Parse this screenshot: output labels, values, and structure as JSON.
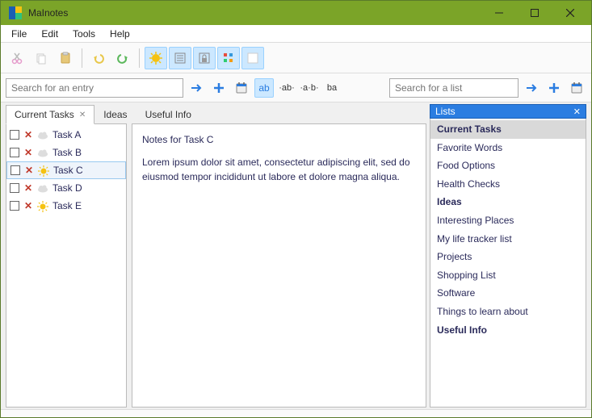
{
  "window": {
    "title": "MaInotes"
  },
  "menu": {
    "file": "File",
    "edit": "Edit",
    "tools": "Tools",
    "help": "Help"
  },
  "search": {
    "entry_placeholder": "Search for an entry",
    "list_placeholder": "Search for a list",
    "opt_ab": "ab",
    "opt_dot_ab": "·ab·",
    "opt_ab_dot": "·a·b·",
    "opt_ba": "ba"
  },
  "tabs": [
    {
      "label": "Current Tasks",
      "closable": true,
      "active": true
    },
    {
      "label": "Ideas",
      "closable": false,
      "active": false
    },
    {
      "label": "Useful Info",
      "closable": false,
      "active": false
    }
  ],
  "tasks": [
    {
      "label": "Task A",
      "selected": false,
      "sunny": false
    },
    {
      "label": "Task B",
      "selected": false,
      "sunny": false
    },
    {
      "label": "Task C",
      "selected": true,
      "sunny": true
    },
    {
      "label": "Task D",
      "selected": false,
      "sunny": false
    },
    {
      "label": "Task E",
      "selected": false,
      "sunny": true
    }
  ],
  "notes": {
    "title": "Notes for Task C",
    "body": "Lorem ipsum dolor sit amet, consectetur adipiscing elit, sed do eiusmod tempor incididunt ut labore et dolore magna aliqua."
  },
  "lists_panel": {
    "title": "Lists",
    "items": [
      {
        "label": "Current Tasks",
        "bold": true,
        "selected": true
      },
      {
        "label": "Favorite Words",
        "bold": false,
        "selected": false
      },
      {
        "label": "Food Options",
        "bold": false,
        "selected": false
      },
      {
        "label": "Health Checks",
        "bold": false,
        "selected": false
      },
      {
        "label": "Ideas",
        "bold": true,
        "selected": false
      },
      {
        "label": "Interesting Places",
        "bold": false,
        "selected": false
      },
      {
        "label": "My life tracker list",
        "bold": false,
        "selected": false
      },
      {
        "label": "Projects",
        "bold": false,
        "selected": false
      },
      {
        "label": "Shopping List",
        "bold": false,
        "selected": false
      },
      {
        "label": "Software",
        "bold": false,
        "selected": false
      },
      {
        "label": "Things to learn about",
        "bold": false,
        "selected": false
      },
      {
        "label": "Useful Info",
        "bold": true,
        "selected": false
      }
    ]
  }
}
